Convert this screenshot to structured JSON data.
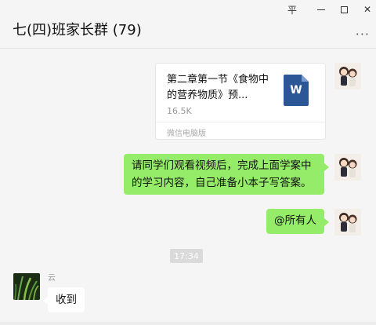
{
  "window": {
    "title": "七(四)班家长群 (79)",
    "controls": {
      "pin_icon": "pin-icon",
      "min_icon": "minimize-icon",
      "max_icon": "maximize-icon",
      "close_icon": "close-icon",
      "close_glyph": "✕",
      "pin_glyph": "平"
    },
    "more_glyph": "···"
  },
  "messages": {
    "file": {
      "name": "第二章第一节《食物中的营养物质》预...",
      "size": "16.5K",
      "source": "微信电脑版",
      "icon_letter": "W",
      "icon_color": "#2b5797"
    },
    "text_1": "请同学们观看视频后，完成上面学案中的学习内容，自己准备小本子写答案。",
    "text_2": "@所有人",
    "timestamp": "17:34",
    "other_sender": "云",
    "other_text": "收到"
  },
  "colors": {
    "own_bubble": "#95ec69",
    "other_bubble": "#ffffff",
    "background": "#f5f5f5"
  }
}
